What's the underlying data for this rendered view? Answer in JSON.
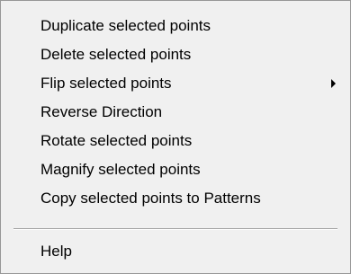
{
  "menu": {
    "items": [
      {
        "label": "Duplicate selected points",
        "submenu": false
      },
      {
        "label": "Delete selected points",
        "submenu": false
      },
      {
        "label": "Flip selected points",
        "submenu": true
      },
      {
        "label": "Reverse Direction",
        "submenu": false
      },
      {
        "label": "Rotate selected points",
        "submenu": false
      },
      {
        "label": "Magnify selected points",
        "submenu": false
      },
      {
        "label": "Copy selected points to Patterns",
        "submenu": false
      },
      {
        "label": "Help",
        "submenu": false
      }
    ]
  },
  "colors": {
    "background": "#f0f0f0",
    "border": "#979797",
    "text": "#000000",
    "separator": "#a0a0a0"
  },
  "icons": {
    "submenu_arrow": "triangle-right"
  }
}
